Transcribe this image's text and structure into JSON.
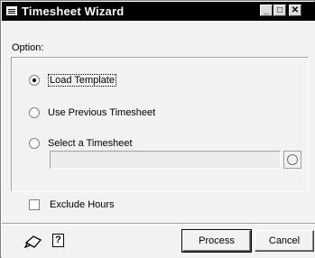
{
  "window": {
    "title": "Timesheet Wizard",
    "minimize": "_",
    "maximize": "□",
    "close": "✕"
  },
  "form": {
    "option_label": "Option:",
    "radios": [
      {
        "label": "Load Template",
        "checked": true
      },
      {
        "label": "Use Previous Timesheet",
        "checked": false
      },
      {
        "label": "Select a Timesheet",
        "checked": false
      }
    ],
    "timesheet_value": "",
    "exclude_hours_label": "Exclude Hours",
    "exclude_hours_checked": false
  },
  "footer": {
    "note_icon": "note-icon",
    "help_icon": "help-icon",
    "help_glyph": "?",
    "process_label": "Process",
    "cancel_label": "Cancel"
  }
}
